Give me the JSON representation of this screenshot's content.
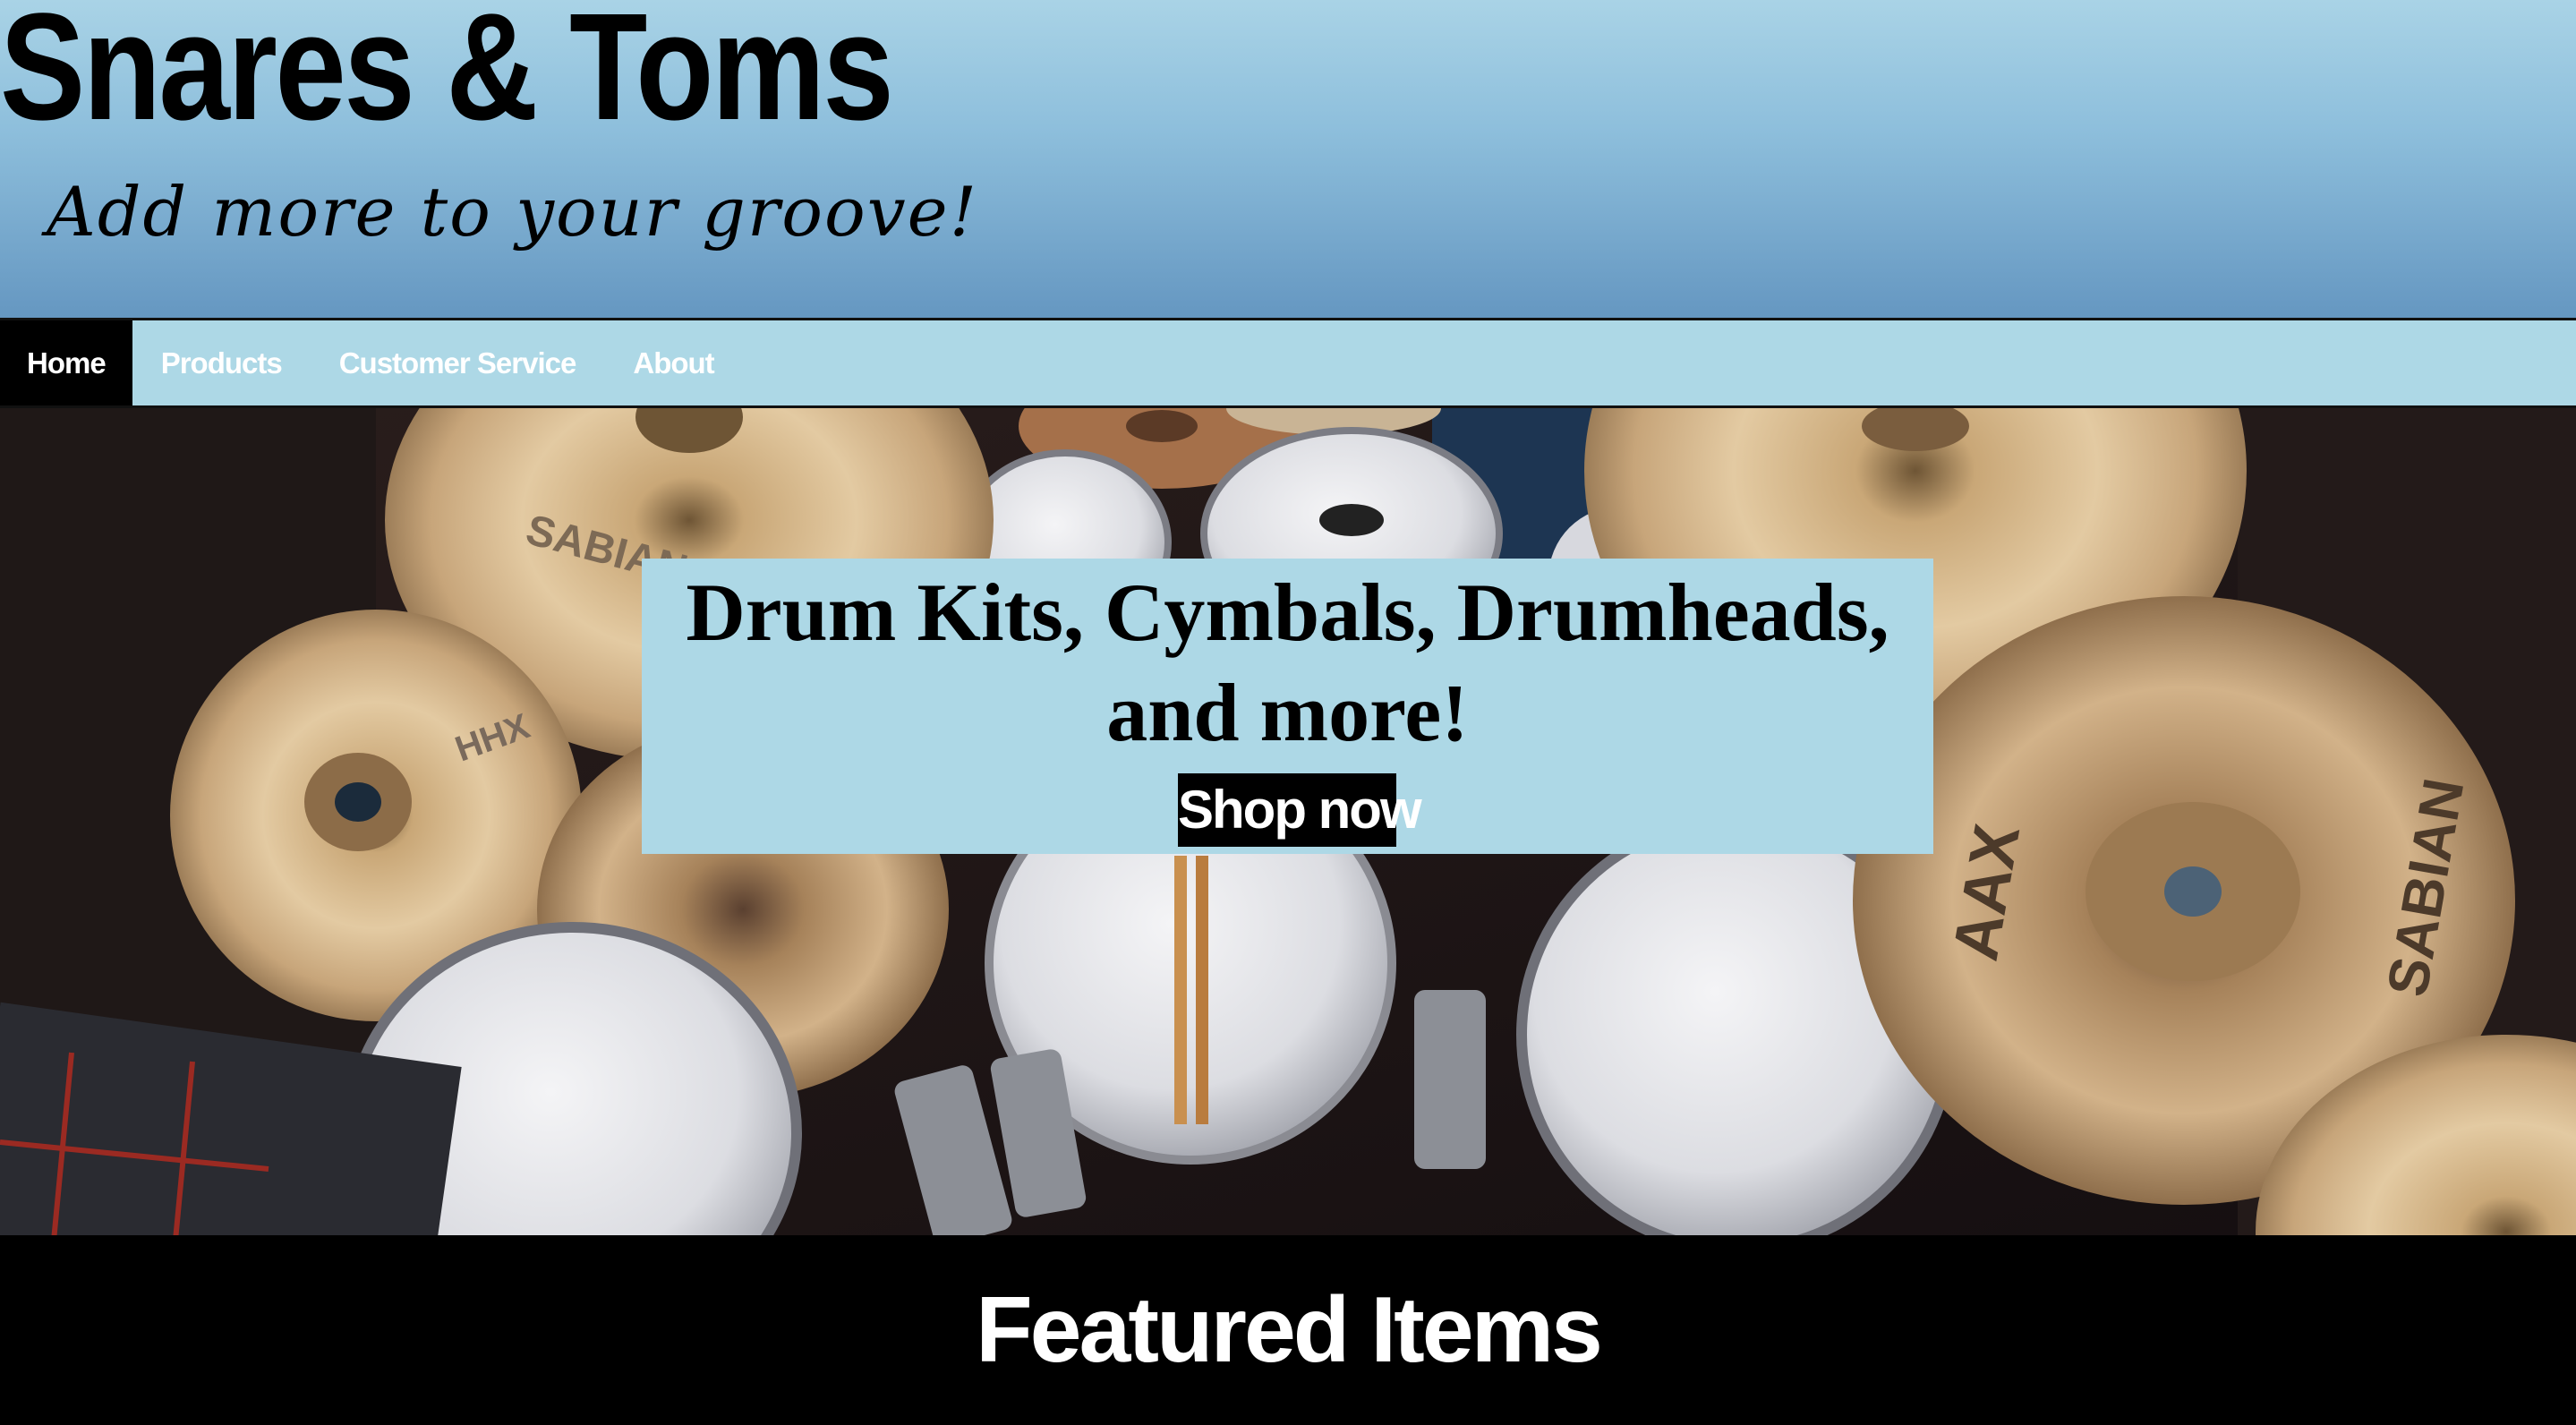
{
  "header": {
    "title": "Snares & Toms",
    "tagline": "Add more to your groove!"
  },
  "nav": {
    "items": [
      {
        "label": "Home",
        "active": true
      },
      {
        "label": "Products",
        "active": false
      },
      {
        "label": "Customer Service",
        "active": false
      },
      {
        "label": "About",
        "active": false
      }
    ]
  },
  "hero": {
    "headline_line1": "Drum Kits, Cymbals, Drumheads,",
    "headline_line2": "and more!",
    "button_label": "Shop now",
    "cymbal_labels": {
      "sabian_top": "SABIAN",
      "hhx": "HHX",
      "aax": "AAX",
      "sabian_right": "SABIAN"
    }
  },
  "featured": {
    "heading": "Featured Items"
  },
  "colors": {
    "header_top": "#a9d3e6",
    "header_bottom": "#6597c1",
    "nav_bg": "#add8e6",
    "nav_active_bg": "#000000",
    "hero_box_bg": "#add8e6",
    "button_bg": "#000000",
    "footer_bg": "#000000"
  }
}
